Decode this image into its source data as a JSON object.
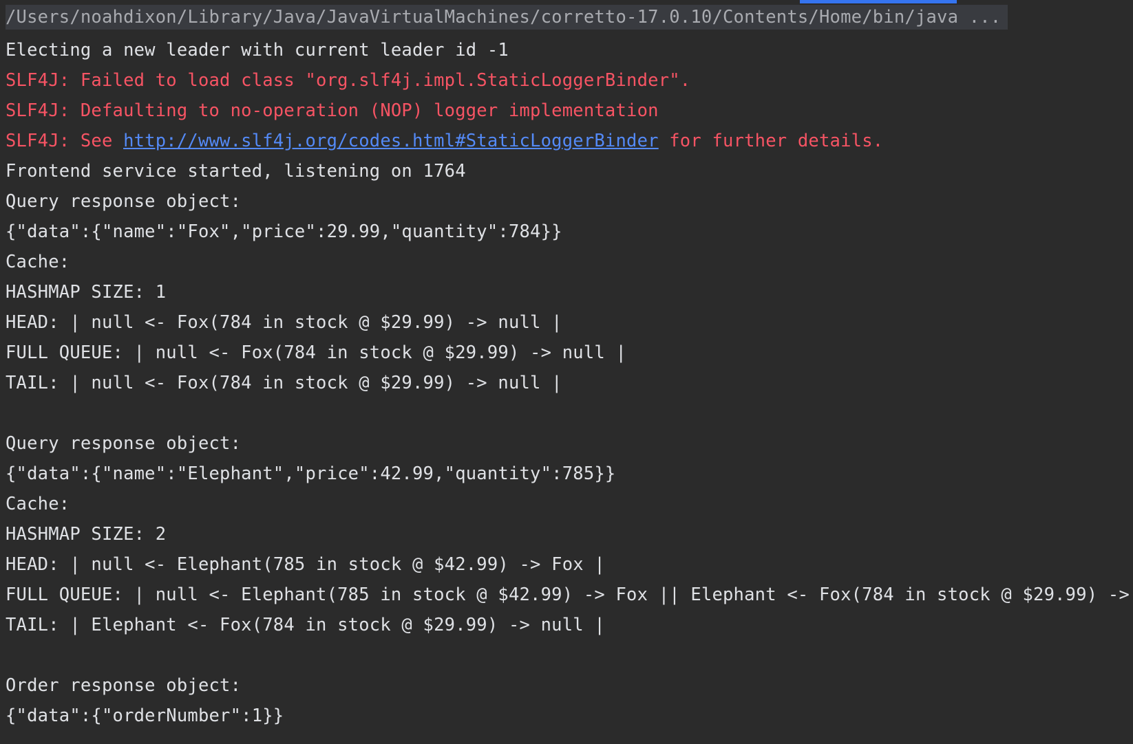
{
  "colors": {
    "background": "#2b2b2b",
    "stdout": "#dfe1e5",
    "stderr": "#f75464",
    "link": "#548af7",
    "command_bg": "#393b40",
    "accent": "#3574f0"
  },
  "console": {
    "command": "/Users/noahdixon/Library/Java/JavaVirtualMachines/corretto-17.0.10/Contents/Home/bin/java ...",
    "lines": {
      "l1": "Electing a new leader with current leader id -1",
      "err1": "SLF4J: Failed to load class \"org.slf4j.impl.StaticLoggerBinder\".",
      "err2": "SLF4J: Defaulting to no-operation (NOP) logger implementation",
      "err3_prefix": "SLF4J: See ",
      "err3_link": "http://www.slf4j.org/codes.html#StaticLoggerBinder",
      "err3_suffix": " for further details.",
      "l5": "Frontend service started, listening on 1764",
      "l6": "Query response object:",
      "l7": "{\"data\":{\"name\":\"Fox\",\"price\":29.99,\"quantity\":784}}",
      "l8": "Cache:",
      "l9": "HASHMAP SIZE: 1",
      "l10": "HEAD: | null <- Fox(784 in stock @ $29.99) -> null |",
      "l11": "FULL QUEUE: | null <- Fox(784 in stock @ $29.99) -> null |",
      "l12": "TAIL: | null <- Fox(784 in stock @ $29.99) -> null |",
      "l14": "Query response object:",
      "l15": "{\"data\":{\"name\":\"Elephant\",\"price\":42.99,\"quantity\":785}}",
      "l16": "Cache:",
      "l17": "HASHMAP SIZE: 2",
      "l18": "HEAD: | null <- Elephant(785 in stock @ $42.99) -> Fox |",
      "l19": "FULL QUEUE: | null <- Elephant(785 in stock @ $42.99) -> Fox || Elephant <- Fox(784 in stock @ $29.99) ->",
      "l20": "TAIL: | Elephant <- Fox(784 in stock @ $29.99) -> null |",
      "l22": "Order response object:",
      "l23": "{\"data\":{\"orderNumber\":1}}"
    }
  }
}
